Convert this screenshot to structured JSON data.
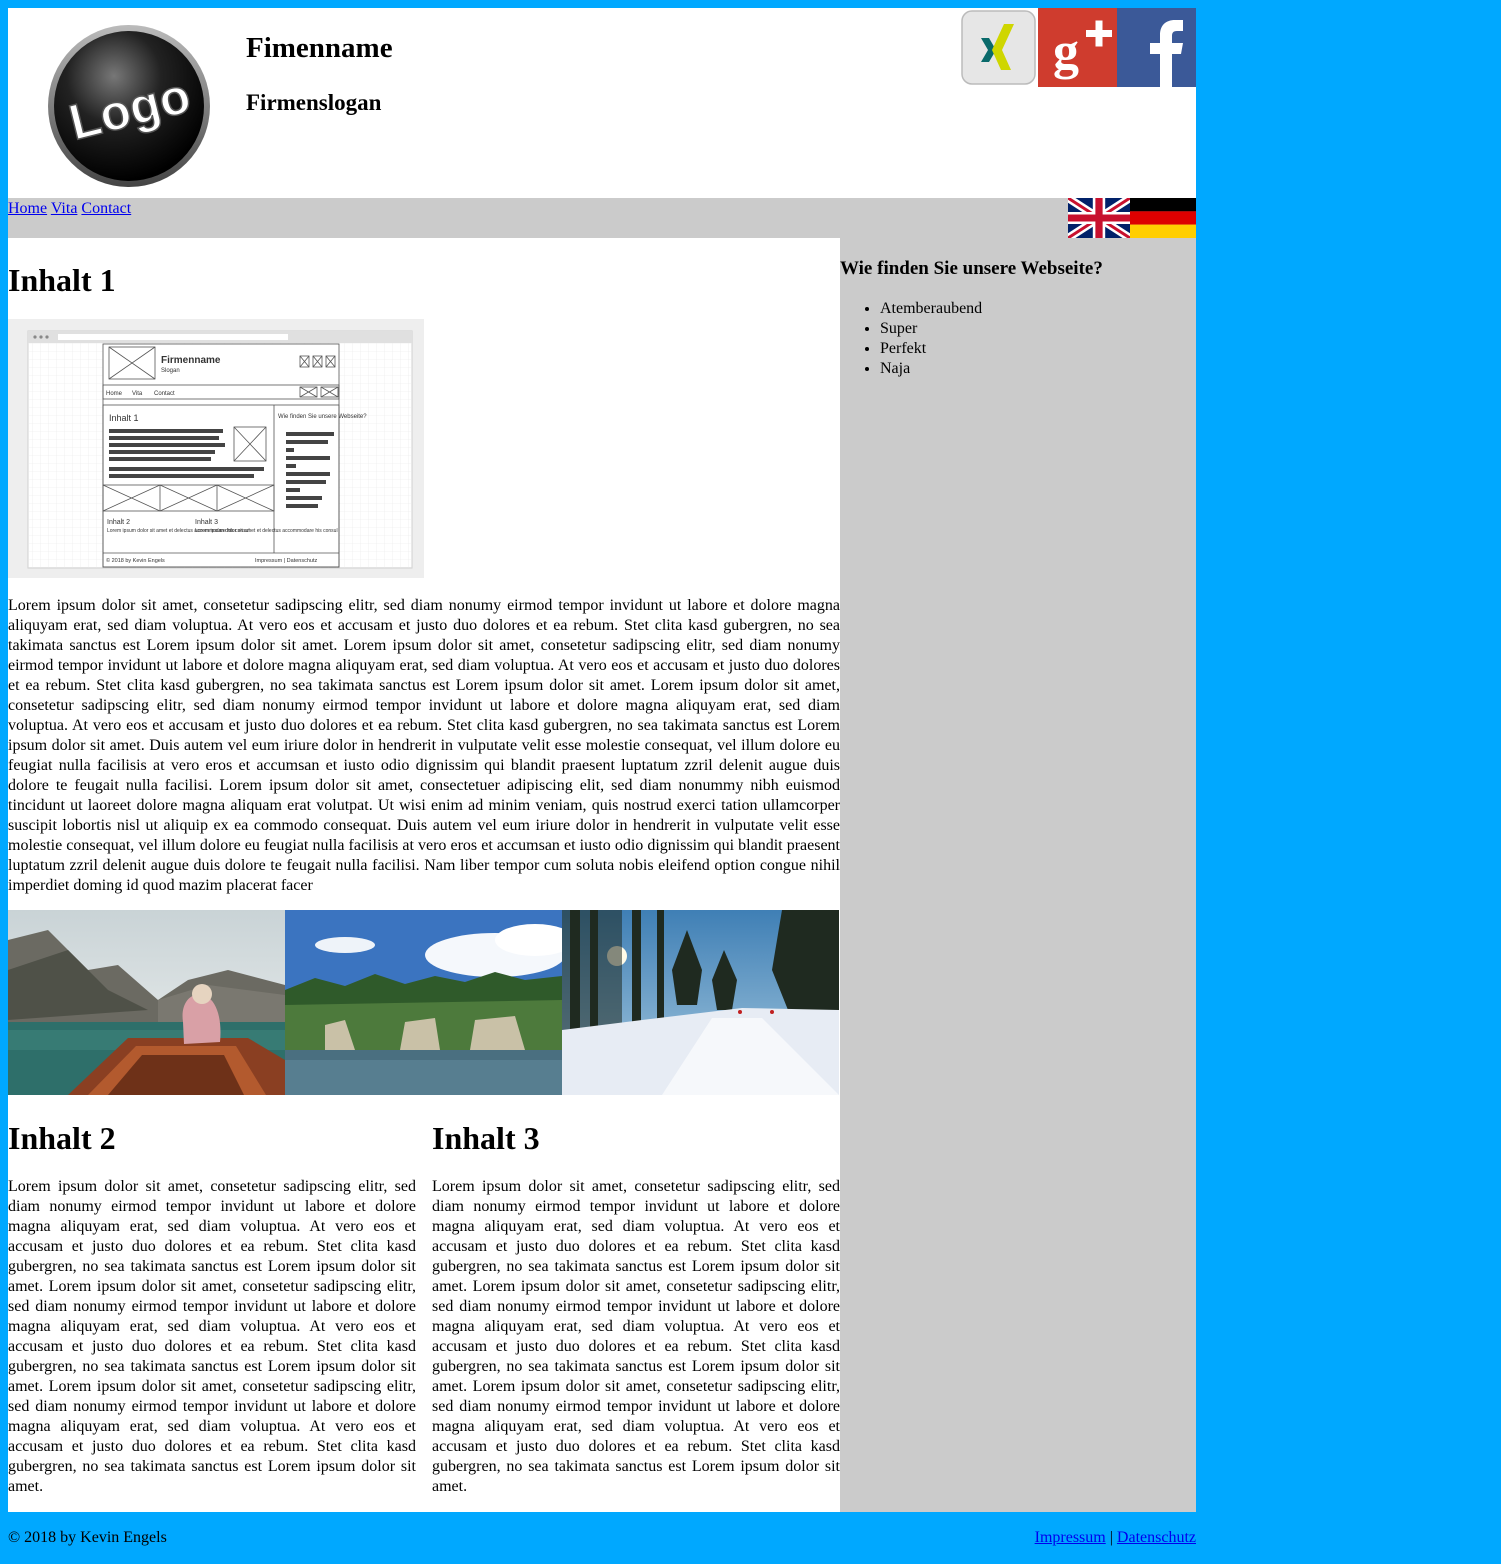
{
  "header": {
    "company": "Fimenname",
    "slogan": "Firmenslogan",
    "logo_text": "Logo",
    "social": [
      "xing-icon",
      "google-plus-icon",
      "facebook-icon"
    ]
  },
  "nav": {
    "items": [
      "Home",
      "Vita",
      "Contact"
    ],
    "flags": [
      "uk-flag",
      "german-flag"
    ]
  },
  "main": {
    "section1": {
      "title": "Inhalt 1",
      "image": {
        "company": "Firmenname",
        "slogan": "Slogan",
        "nav": [
          "Home",
          "Vita",
          "Contact"
        ],
        "content_title": "Inhalt 1",
        "sidebar_title": "Wie finden Sie unsere Webseite?",
        "col2_title": "Inhalt 2",
        "col3_title": "Inhalt 3",
        "col_text": "Lorem ipsum dolor sit amet et delectus accommodare his consul",
        "footer_left": "&copy; 2018 by Kevin Engels",
        "footer_right": "Impressum | Datenschutz"
      },
      "text": "Lorem ipsum dolor sit amet, consetetur sadipscing elitr, sed diam nonumy eirmod tempor invidunt ut labore et dolore magna aliquyam erat, sed diam voluptua. At vero eos et accusam et justo duo dolores et ea rebum. Stet clita kasd gubergren, no sea takimata sanctus est Lorem ipsum dolor sit amet. Lorem ipsum dolor sit amet, consetetur sadipscing elitr, sed diam nonumy eirmod tempor invidunt ut labore et dolore magna aliquyam erat, sed diam voluptua. At vero eos et accusam et justo duo dolores et ea rebum. Stet clita kasd gubergren, no sea takimata sanctus est Lorem ipsum dolor sit amet. Lorem ipsum dolor sit amet, consetetur sadipscing elitr, sed diam nonumy eirmod tempor invidunt ut labore et dolore magna aliquyam erat, sed diam voluptua. At vero eos et accusam et justo duo dolores et ea rebum. Stet clita kasd gubergren, no sea takimata sanctus est Lorem ipsum dolor sit amet. Duis autem vel eum iriure dolor in hendrerit in vulputate velit esse molestie consequat, vel illum dolore eu feugiat nulla facilisis at vero eros et accumsan et iusto odio dignissim qui blandit praesent luptatum zzril delenit augue duis dolore te feugait nulla facilisi. Lorem ipsum dolor sit amet, consectetuer adipiscing elit, sed diam nonummy nibh euismod tincidunt ut laoreet dolore magna aliquam erat volutpat. Ut wisi enim ad minim veniam, quis nostrud exerci tation ullamcorper suscipit lobortis nisl ut aliquip ex ea commodo consequat. Duis autem vel eum iriure dolor in hendrerit in vulputate velit esse molestie consequat, vel illum dolore eu feugiat nulla facilisis at vero eros et accumsan et iusto odio dignissim qui blandit praesent luptatum zzril delenit augue duis dolore te feugait nulla facilisi. Nam liber tempor cum soluta nobis eleifend option congue nihil imperdiet doming id quod mazim placerat facer"
    },
    "gallery": [
      "lake-boat-photo",
      "forest-lake-photo",
      "snowy-forest-photo"
    ],
    "section2": {
      "title": "Inhalt 2",
      "text": "Lorem ipsum dolor sit amet, consetetur sadipscing elitr, sed diam nonumy eirmod tempor invidunt ut labore et dolore magna aliquyam erat, sed diam voluptua. At vero eos et accusam et justo duo dolores et ea rebum. Stet clita kasd gubergren, no sea takimata sanctus est Lorem ipsum dolor sit amet. Lorem ipsum dolor sit amet, consetetur sadipscing elitr, sed diam nonumy eirmod tempor invidunt ut labore et dolore magna aliquyam erat, sed diam voluptua. At vero eos et accusam et justo duo dolores et ea rebum. Stet clita kasd gubergren, no sea takimata sanctus est Lorem ipsum dolor sit amet. Lorem ipsum dolor sit amet, consetetur sadipscing elitr, sed diam nonumy eirmod tempor invidunt ut labore et dolore magna aliquyam erat, sed diam voluptua. At vero eos et accusam et justo duo dolores et ea rebum. Stet clita kasd gubergren, no sea takimata sanctus est Lorem ipsum dolor sit amet."
    },
    "section3": {
      "title": "Inhalt 3",
      "text": "Lorem ipsum dolor sit amet, consetetur sadipscing elitr, sed diam nonumy eirmod tempor invidunt ut labore et dolore magna aliquyam erat, sed diam voluptua. At vero eos et accusam et justo duo dolores et ea rebum. Stet clita kasd gubergren, no sea takimata sanctus est Lorem ipsum dolor sit amet. Lorem ipsum dolor sit amet, consetetur sadipscing elitr, sed diam nonumy eirmod tempor invidunt ut labore et dolore magna aliquyam erat, sed diam voluptua. At vero eos et accusam et justo duo dolores et ea rebum. Stet clita kasd gubergren, no sea takimata sanctus est Lorem ipsum dolor sit amet. Lorem ipsum dolor sit amet, consetetur sadipscing elitr, sed diam nonumy eirmod tempor invidunt ut labore et dolore magna aliquyam erat, sed diam voluptua. At vero eos et accusam et justo duo dolores et ea rebum. Stet clita kasd gubergren, no sea takimata sanctus est Lorem ipsum dolor sit amet."
    }
  },
  "aside": {
    "title": "Wie finden Sie unsere Webseite?",
    "items": [
      "Atemberaubend",
      "Super",
      "Perfekt",
      "Naja"
    ]
  },
  "footer": {
    "copyright": "© 2018 by Kevin Engels",
    "impressum": "Impressum",
    "separator": " | ",
    "datenschutz": "Datenschutz"
  },
  "colors": {
    "page_bg": "#00a8ff",
    "nav_bg": "#cbcbcb",
    "link": "#0000ee"
  }
}
